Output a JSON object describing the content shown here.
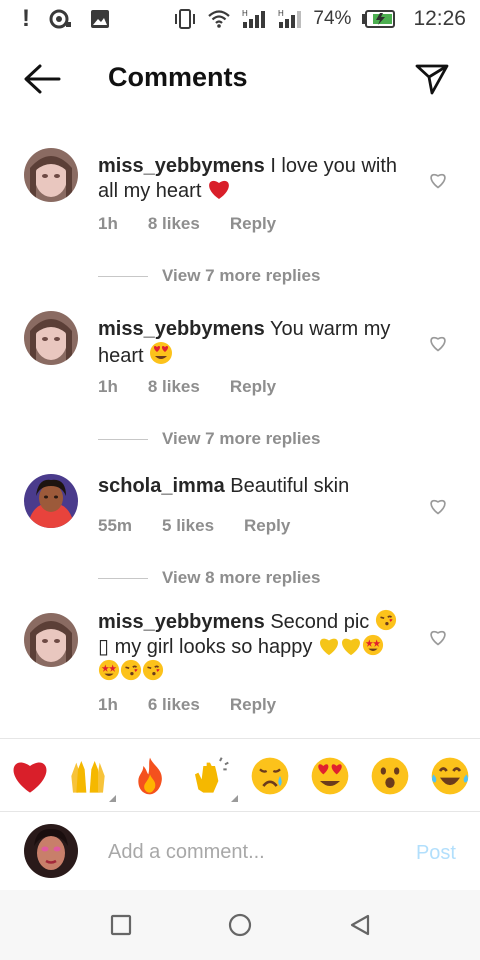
{
  "status_bar": {
    "alert": "!",
    "battery_percent": "74%",
    "time": "12:26",
    "icons": [
      "alert-icon",
      "camera-notification-icon",
      "image-icon",
      "vibrate-icon",
      "wifi-icon",
      "signal-icon",
      "signal-icon",
      "battery-charging-icon"
    ]
  },
  "header": {
    "title": "Comments",
    "back_icon": "arrow-left-icon",
    "send_icon": "paper-plane-icon"
  },
  "comments": [
    {
      "username": "miss_yebbymens",
      "text": " I love you with all my heart ",
      "emojis": [
        "red-heart"
      ],
      "time": "1h",
      "likes": "8 likes",
      "reply": "Reply",
      "replies_label": "View 7 more replies"
    },
    {
      "username": "miss_yebbymens",
      "text": " You warm my heart ",
      "emojis": [
        "heart-eyes"
      ],
      "time": "1h",
      "likes": "8 likes",
      "reply": "Reply",
      "replies_label": "View 7 more replies"
    },
    {
      "username": "schola_imma",
      "text": " Beautiful skin",
      "emojis": [],
      "time": "55m",
      "likes": "5 likes",
      "reply": "Reply",
      "replies_label": "View 8 more replies"
    },
    {
      "username": "miss_yebbymens",
      "text": " Second pic ",
      "text2": "▯ my girl looks so happy ",
      "emojis": [
        "kissing-face",
        "yellow-heart",
        "yellow-heart",
        "star-struck",
        "star-struck",
        "kissing-face",
        "kissing-face"
      ],
      "time": "1h",
      "likes": "6 likes",
      "reply": "Reply"
    }
  ],
  "reactions": [
    "red-heart",
    "raising-hands",
    "fire",
    "clapping-hands",
    "crying-face",
    "heart-eyes",
    "astonished-face",
    "tears-of-joy"
  ],
  "composer": {
    "placeholder": "Add a comment...",
    "post_label": "Post"
  },
  "nav": [
    "recent-apps-icon",
    "home-icon",
    "back-icon"
  ],
  "colors": {
    "text": "#262626",
    "secondary": "#8e8e8e",
    "post_disabled": "#b2dffc",
    "heart_red": "#e0202e"
  }
}
